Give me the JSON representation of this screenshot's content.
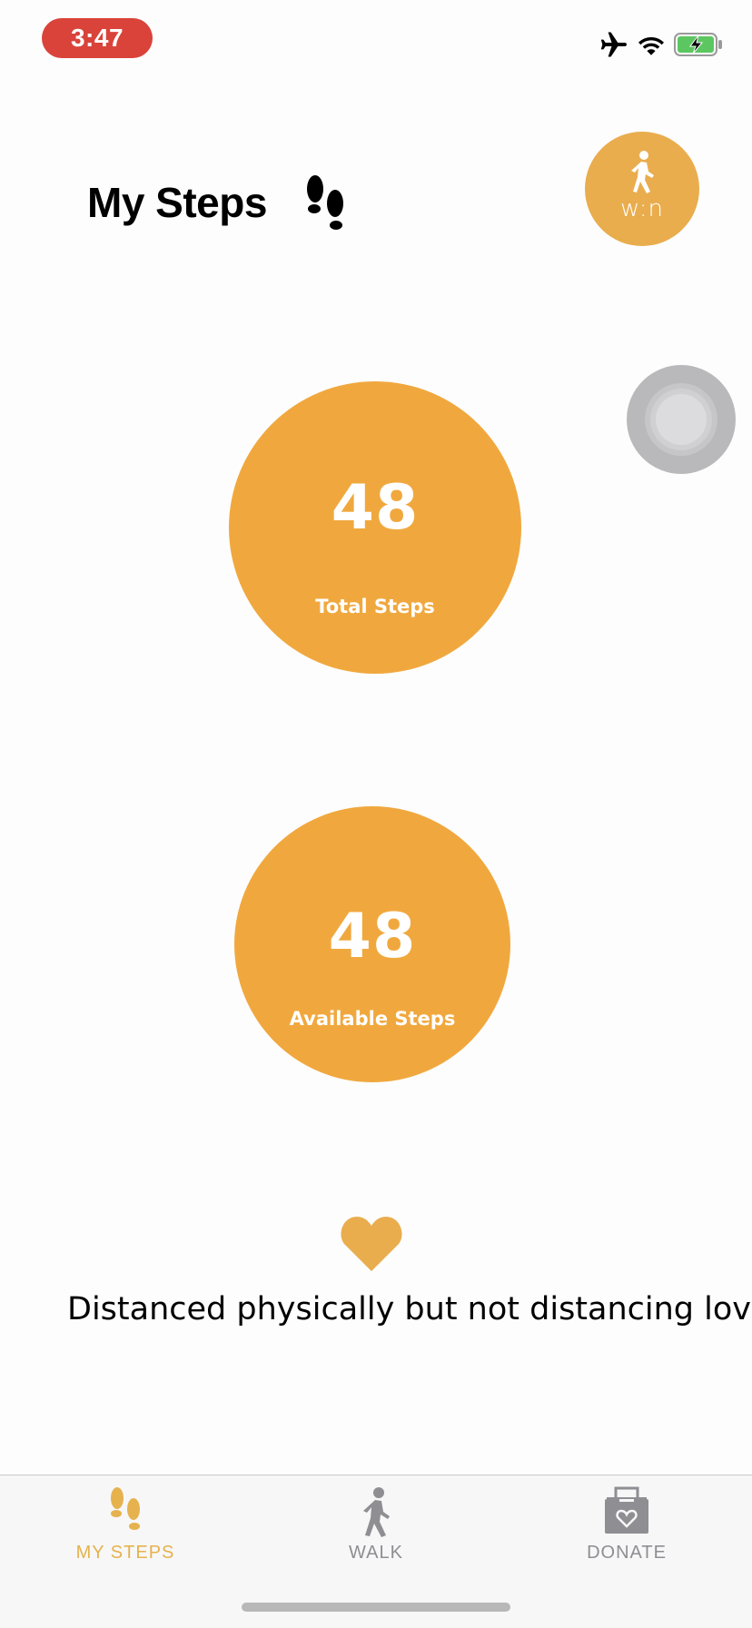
{
  "status_bar": {
    "time": "3:47",
    "icons": [
      "airplane-icon",
      "wifi-icon",
      "battery-charging-icon"
    ],
    "battery_color": "#5cc761"
  },
  "header": {
    "title": "My Steps",
    "title_icon": "footprints-icon",
    "win_button": {
      "label": "w:n",
      "icon": "walker-icon",
      "color": "#e9ad4e"
    }
  },
  "stats": {
    "total": {
      "value": "48",
      "label": "Total Steps"
    },
    "available": {
      "value": "48",
      "label": "Available Steps"
    },
    "circle_color": "#f0a83e"
  },
  "message": {
    "icon": "heart-icon",
    "text": "Distanced physically but not distancing love."
  },
  "tab_bar": {
    "active_color": "#e6b24e",
    "inactive_color": "#8e8e93",
    "tabs": [
      {
        "label": "MY STEPS",
        "icon": "footprints-icon",
        "active": true
      },
      {
        "label": "WALK",
        "icon": "walker-icon",
        "active": false
      },
      {
        "label": "DONATE",
        "icon": "donation-box-icon",
        "active": false
      }
    ]
  }
}
